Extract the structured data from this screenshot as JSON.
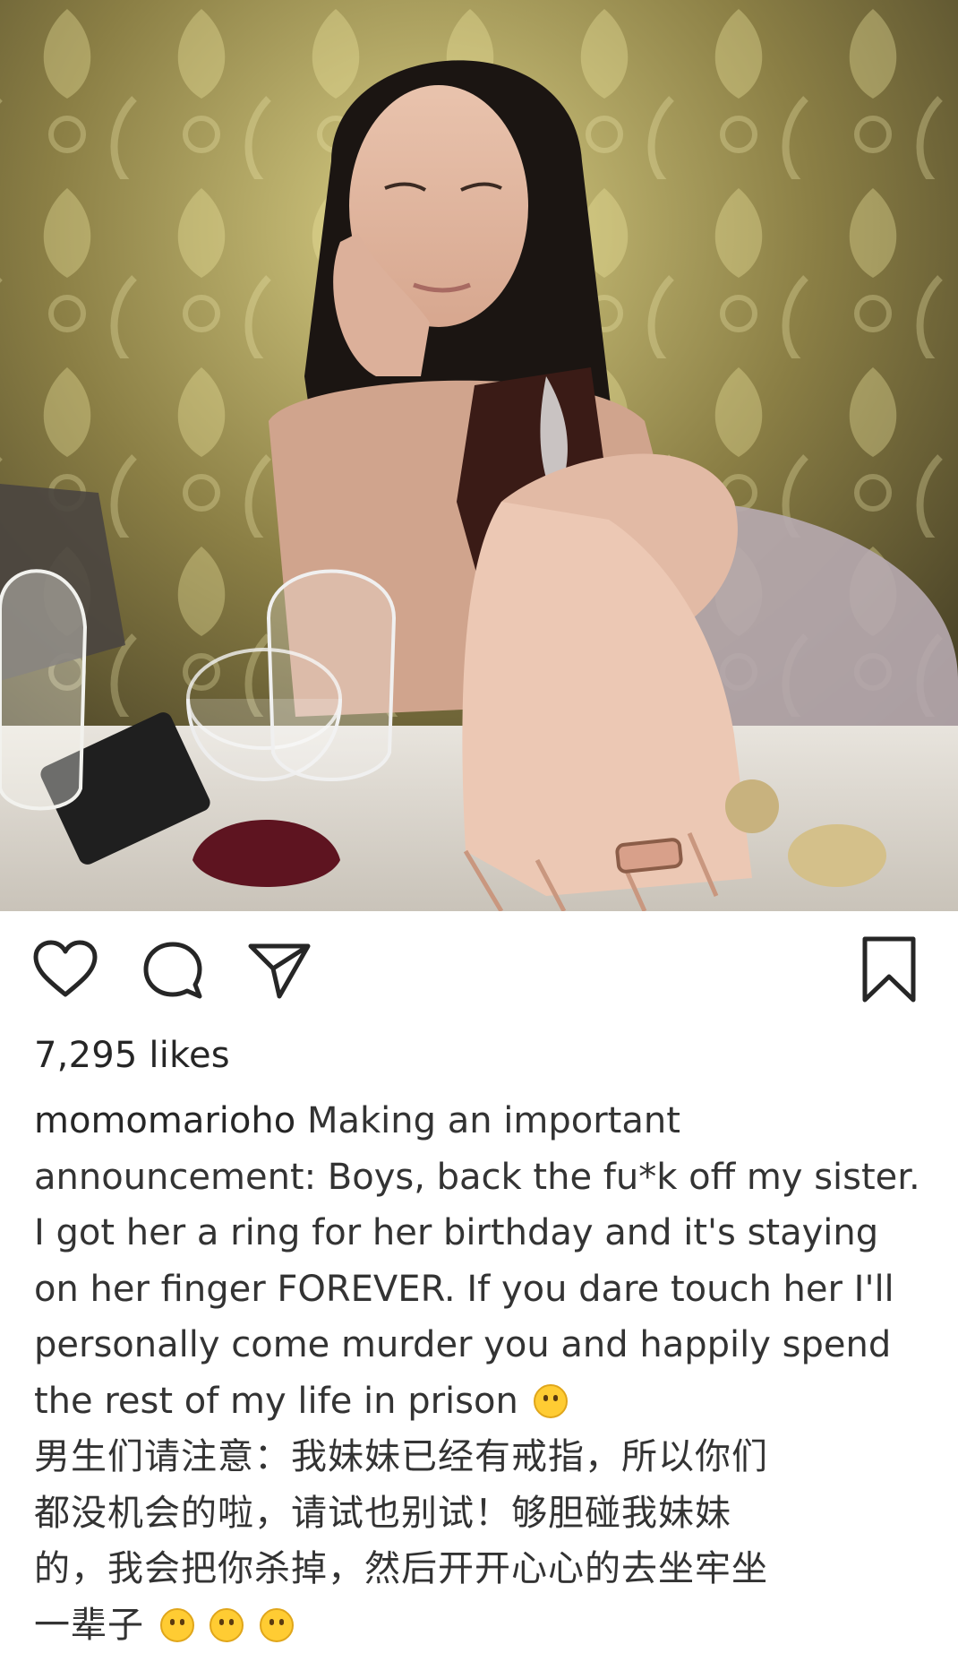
{
  "post": {
    "likes": "7,295 likes",
    "username": "momomarioho",
    "caption_en": "Making an important announcement: Boys, back the fu*k off my sister. I got her a ring for her birthday and it's staying on her finger FOREVER. If you dare touch her I'll personally come murder you and happily spend the rest of my life in prison",
    "caption_zh_lines": [
      "男生们请注意：我妹妹已经有戒指，所以你们",
      "都没机会的啦，请试也别试！够胆碰我妹妹",
      "的，我会把你杀掉，然后开开心心的去坐牢坐",
      "一辈子"
    ]
  },
  "actions": {
    "like_icon": "heart-outline",
    "comment_icon": "speech-bubble",
    "share_icon": "paper-plane",
    "save_icon": "bookmark"
  },
  "colors": {
    "text": "#262626",
    "emoji": "#ffcc33"
  }
}
